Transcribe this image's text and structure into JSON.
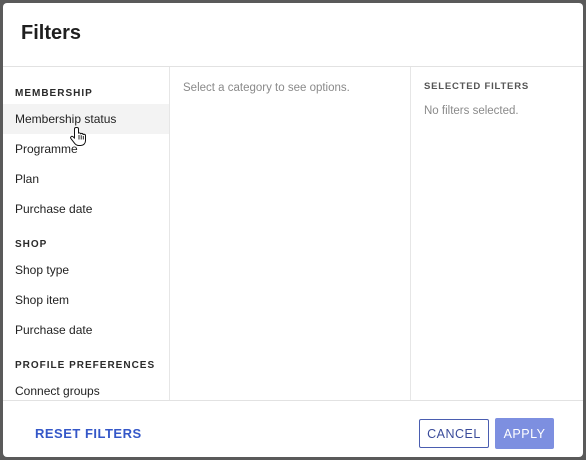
{
  "dialog": {
    "title": "Filters"
  },
  "categories": {
    "groups": [
      {
        "label": "MEMBERSHIP",
        "items": [
          "Membership status",
          "Programme",
          "Plan",
          "Purchase date"
        ]
      },
      {
        "label": "SHOP",
        "items": [
          "Shop type",
          "Shop item",
          "Purchase date"
        ]
      },
      {
        "label": "PROFILE PREFERENCES",
        "items": [
          "Connect groups"
        ]
      }
    ],
    "hovered_item": "Membership status"
  },
  "options": {
    "hint": "Select a category to see options."
  },
  "selected": {
    "header": "SELECTED FILTERS",
    "empty_text": "No filters selected."
  },
  "footer": {
    "reset_label": "RESET FILTERS",
    "cancel_label": "CANCEL",
    "apply_label": "APPLY"
  },
  "icons": {
    "cursor": "hand-pointer-icon"
  },
  "colors": {
    "link_blue": "#3457c8",
    "apply_bg": "#7d8fe0",
    "cancel_border": "#4a5db0"
  }
}
